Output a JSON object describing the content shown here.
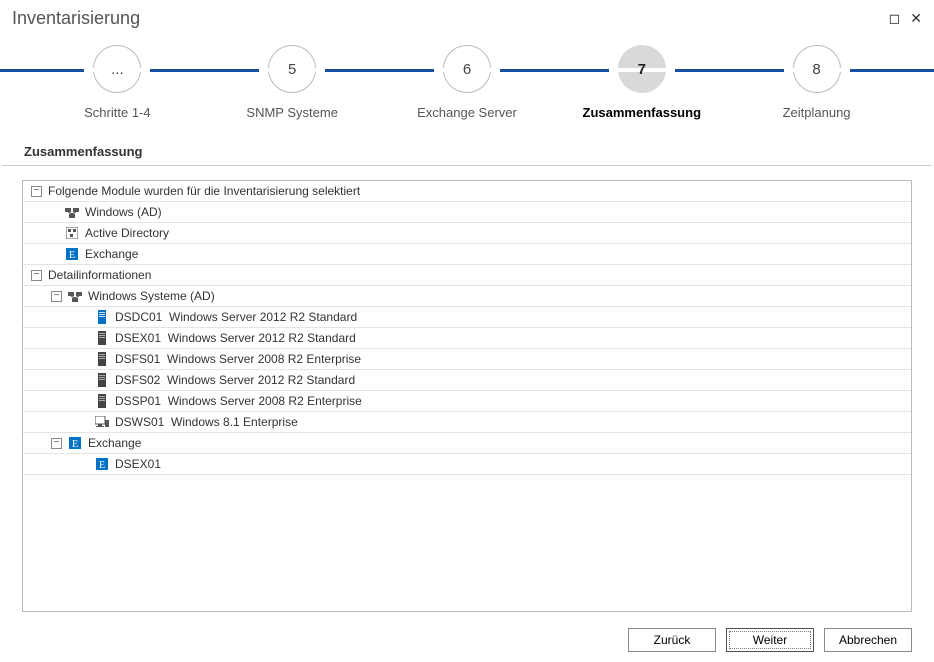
{
  "window": {
    "title": "Inventarisierung"
  },
  "stepper": {
    "steps": [
      {
        "badge": "...",
        "label": "Schritte 1-4"
      },
      {
        "badge": "5",
        "label": "SNMP Systeme"
      },
      {
        "badge": "6",
        "label": "Exchange Server"
      },
      {
        "badge": "7",
        "label": "Zusammenfassung",
        "active": true
      },
      {
        "badge": "8",
        "label": "Zeitplanung"
      }
    ]
  },
  "section": {
    "title": "Zusammenfassung"
  },
  "tree": {
    "modules_header": "Folgende Module wurden für die Inventarisierung selektiert",
    "modules": [
      {
        "icon": "windows-ad",
        "label": "Windows (AD)"
      },
      {
        "icon": "active-directory",
        "label": "Active Directory"
      },
      {
        "icon": "exchange",
        "label": "Exchange"
      }
    ],
    "details_header": "Detailinformationen",
    "win_group": "Windows Systeme (AD)",
    "win_systems": [
      {
        "host": "DSDC01",
        "os": "Windows Server 2012 R2 Standard",
        "icon": "server-blue"
      },
      {
        "host": "DSEX01",
        "os": "Windows Server 2012 R2 Standard",
        "icon": "server"
      },
      {
        "host": "DSFS01",
        "os": "Windows Server 2008 R2 Enterprise",
        "icon": "server"
      },
      {
        "host": "DSFS02",
        "os": "Windows Server 2012 R2 Standard",
        "icon": "server"
      },
      {
        "host": "DSSP01",
        "os": "Windows Server 2008 R2 Enterprise",
        "icon": "server"
      },
      {
        "host": "DSWS01",
        "os": "Windows 8.1 Enterprise",
        "icon": "workstation"
      }
    ],
    "exchange_group": "Exchange",
    "exchange_systems": [
      {
        "host": "DSEX01"
      }
    ]
  },
  "buttons": {
    "back": "Zurück",
    "next": "Weiter",
    "cancel": "Abbrechen"
  }
}
